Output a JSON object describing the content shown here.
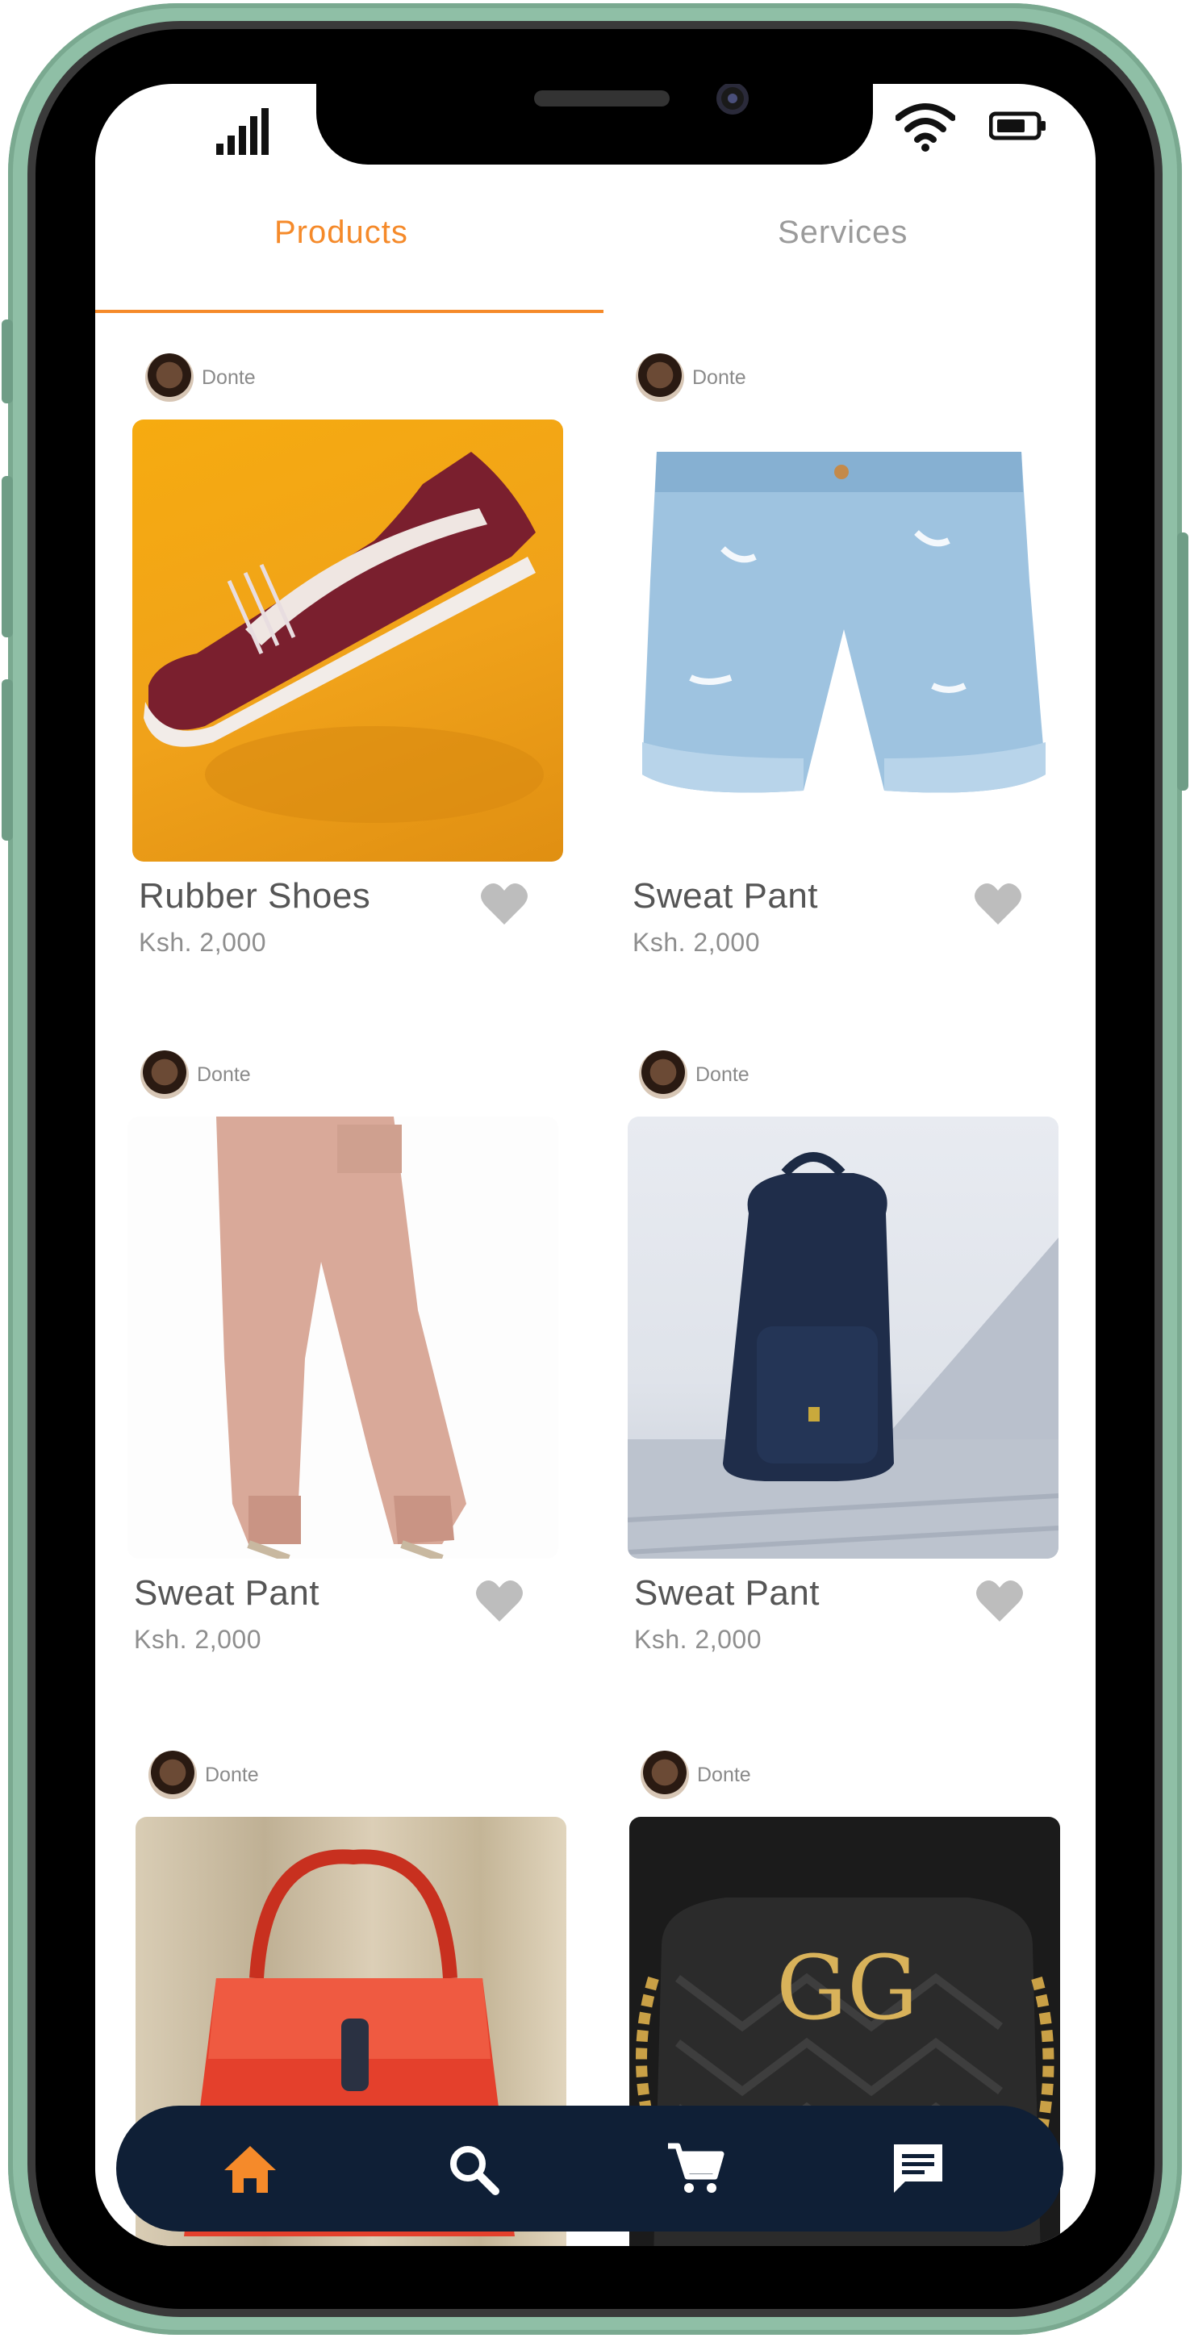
{
  "tabs": [
    {
      "label": "Products",
      "active": true
    },
    {
      "label": "Services",
      "active": false
    }
  ],
  "products": [
    {
      "seller": "Donte",
      "name": "Rubber Shoes",
      "price": "Ksh. 2,000",
      "image": "maroon-sneaker-on-orange"
    },
    {
      "seller": "Donte",
      "name": "Sweat Pant",
      "price": "Ksh. 2,000",
      "image": "denim-shorts"
    },
    {
      "seller": "Donte",
      "name": "Sweat Pant",
      "price": "Ksh. 2,000",
      "image": "pink-joggers"
    },
    {
      "seller": "Donte",
      "name": "Sweat Pant",
      "price": "Ksh. 2,000",
      "image": "navy-backpack"
    },
    {
      "seller": "Donte",
      "name": "",
      "price": "",
      "image": "red-handbag"
    },
    {
      "seller": "Donte",
      "name": "",
      "price": "",
      "image": "black-gg-bag"
    }
  ],
  "bottom_nav": [
    {
      "icon": "home-icon",
      "active": true
    },
    {
      "icon": "search-icon",
      "active": false
    },
    {
      "icon": "cart-icon",
      "active": false
    },
    {
      "icon": "chat-icon",
      "active": false
    }
  ],
  "colors": {
    "accent": "#f58a2a",
    "nav_bg": "#0f1f36",
    "frame": "#8fbfa6",
    "heart": "#bdbdbd"
  }
}
